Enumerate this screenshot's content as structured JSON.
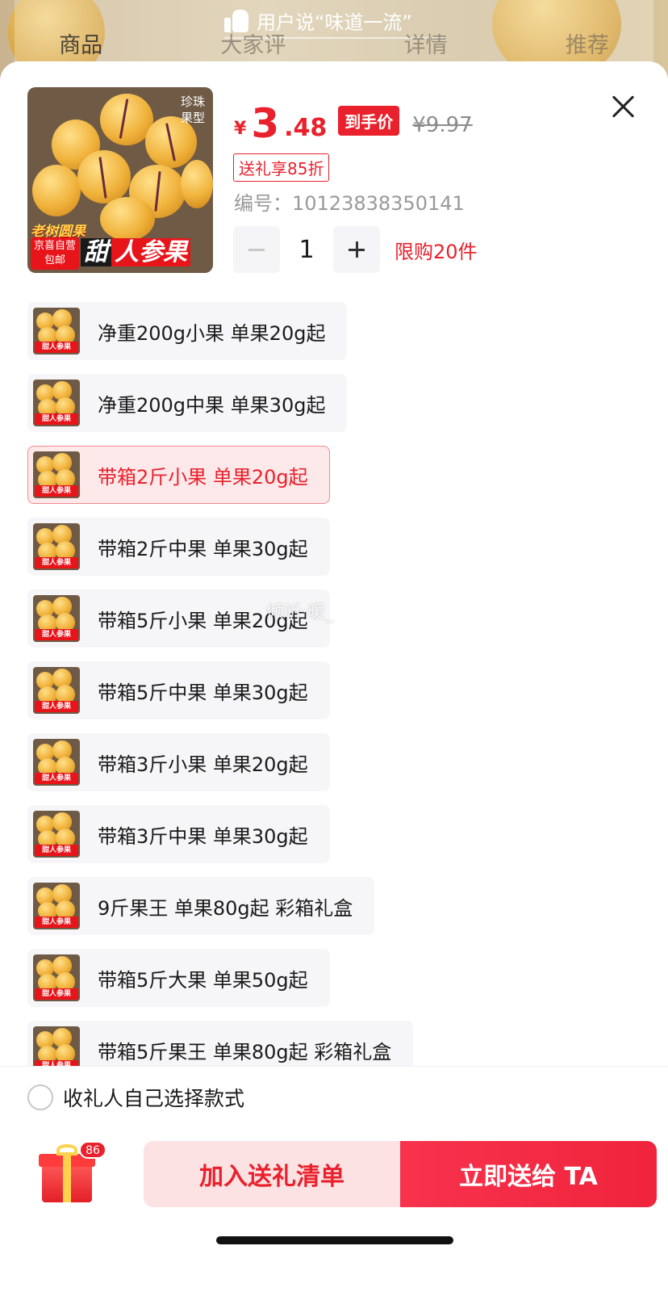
{
  "background": {
    "banner_text": "用户说“味道一流”",
    "tabs": [
      {
        "label": "商品"
      },
      {
        "label": "大家评"
      },
      {
        "label": "详情"
      },
      {
        "label": "推荐"
      }
    ]
  },
  "product": {
    "image_tag": "珍珠果型",
    "image_tag_line1": "珍珠",
    "image_tag_line2": "果型",
    "image_banner_old": "老树圆果",
    "image_banner_shop_line1": "京喜自营",
    "image_banner_shop_line2": "包邮",
    "image_title_sweet": "甜",
    "image_title_rest": "人参果",
    "currency": "¥",
    "price_int": "3",
    "price_dec": ".48",
    "hand_price_label": "到手价",
    "original_price": "¥9.97",
    "discount_label": "送礼享85折",
    "sku_number": "编号：10123838350141",
    "quantity": "1",
    "limit_label": "限购20件"
  },
  "options": [
    {
      "label": "净重200g小果 单果20g起",
      "selected": false
    },
    {
      "label": "净重200g中果 单果30g起",
      "selected": false
    },
    {
      "label": "带箱2斤小果 单果20g起",
      "selected": true
    },
    {
      "label": "带箱2斤中果 单果30g起",
      "selected": false
    },
    {
      "label": "带箱5斤小果 单果20g起",
      "selected": false
    },
    {
      "label": "带箱5斤中果 单果30g起",
      "selected": false
    },
    {
      "label": "带箱3斤小果 单果20g起",
      "selected": false
    },
    {
      "label": "带箱3斤中果 单果30g起",
      "selected": false
    },
    {
      "label": "9斤果王 单果80g起 彩箱礼盒",
      "selected": false
    },
    {
      "label": "带箱5斤大果 单果50g起",
      "selected": false
    },
    {
      "label": "带箱5斤果王 单果80g起 彩箱礼盒",
      "selected": false
    }
  ],
  "option_thumb_label": "甜人参果",
  "watermark": "倾听·暖_",
  "bottom": {
    "choose_label": "收礼人自己选择款式",
    "gift_badge": "86",
    "add_button": "加入送礼清单",
    "send_button": "立即送给 TA"
  },
  "colors": {
    "accent": "#e9212c",
    "selected_bg": "#fde9ea",
    "chip_bg": "#f6f6f8"
  }
}
